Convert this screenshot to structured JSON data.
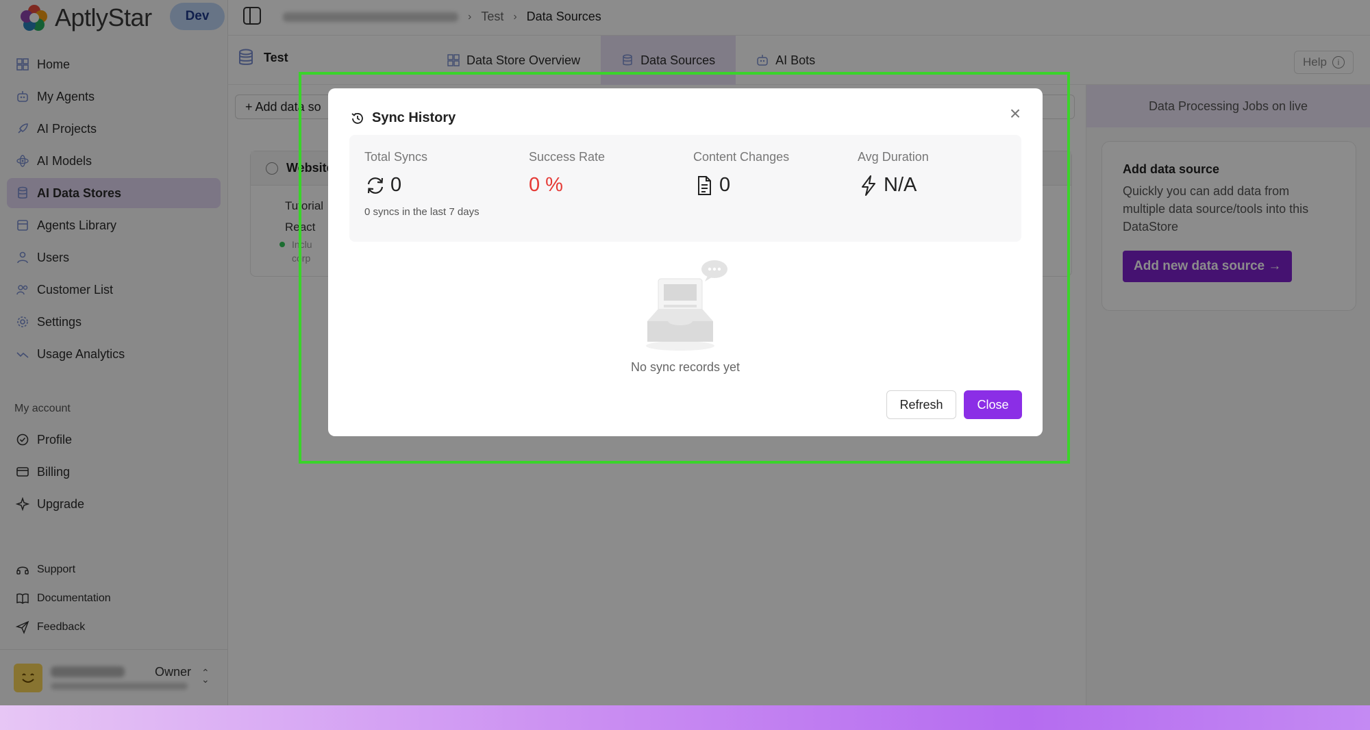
{
  "app": {
    "brand_name": "AptlyStar",
    "env_badge": "Dev",
    "accent_color": "#8b2ee6"
  },
  "sidebar": {
    "items": [
      {
        "label": "Home",
        "icon": "home-icon"
      },
      {
        "label": "My Agents",
        "icon": "robot-icon"
      },
      {
        "label": "AI Projects",
        "icon": "rocket-icon"
      },
      {
        "label": "AI Models",
        "icon": "atom-icon"
      },
      {
        "label": "AI Data Stores",
        "icon": "database-icon",
        "active": true
      },
      {
        "label": "Agents Library",
        "icon": "library-icon"
      },
      {
        "label": "Users",
        "icon": "user-icon"
      },
      {
        "label": "Customer List",
        "icon": "people-icon"
      },
      {
        "label": "Settings",
        "icon": "gear-icon"
      },
      {
        "label": "Usage Analytics",
        "icon": "analytics-icon"
      }
    ],
    "account_title": "My account",
    "account_items": [
      {
        "label": "Profile",
        "icon": "check-circle-icon"
      },
      {
        "label": "Billing",
        "icon": "card-icon"
      },
      {
        "label": "Upgrade",
        "icon": "sparkle-icon"
      }
    ],
    "footer_items": [
      {
        "label": "Support",
        "icon": "headset-icon"
      },
      {
        "label": "Documentation",
        "icon": "book-icon"
      },
      {
        "label": "Feedback",
        "icon": "send-icon"
      }
    ],
    "user": {
      "role": "Owner"
    }
  },
  "breadcrumb": {
    "items": [
      "Test",
      "Data Sources"
    ]
  },
  "datastore": {
    "title": "Test",
    "tabs": [
      "Data Store Overview",
      "Data Sources",
      "AI Bots"
    ],
    "active_tab": "Data Sources",
    "help_label": "Help"
  },
  "main": {
    "add_button": "+ Add data so",
    "card_title": "Website",
    "card_lines": [
      "Tutorial",
      "React"
    ],
    "card_small": [
      "Inclu",
      "corp"
    ]
  },
  "right_panel": {
    "header": "Data Processing Jobs on live",
    "card_title": "Add data source",
    "card_desc": "Quickly you can add data from multiple data source/tools into this DataStore",
    "card_button": "Add new data source →"
  },
  "modal": {
    "title": "Sync History",
    "stats": [
      {
        "label": "Total Syncs",
        "value": "0",
        "icon": "sync-icon"
      },
      {
        "label": "Success Rate",
        "value": "0 %",
        "icon": ""
      },
      {
        "label": "Content Changes",
        "value": "0",
        "icon": "document-icon"
      },
      {
        "label": "Avg Duration",
        "value": "N/A",
        "icon": "lightning-icon"
      }
    ],
    "total_sub": "0 syncs in the last 7 days",
    "empty_text": "No sync records yet",
    "refresh_label": "Refresh",
    "close_label": "Close"
  }
}
